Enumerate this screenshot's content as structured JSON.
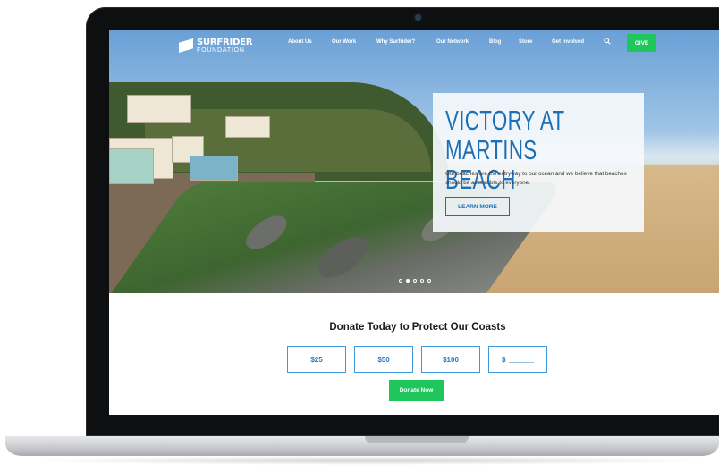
{
  "nav": {
    "logo_title": "SURFRIDER",
    "logo_subtitle": "FOUNDATION",
    "items": [
      "About Us",
      "Our Work",
      "Why Surfrider?",
      "Our Network",
      "Blog",
      "Store",
      "Get Involved"
    ],
    "give_label": "GIVE",
    "search_icon": "search-icon"
  },
  "hero": {
    "title": "VICTORY AT MARTINS BEACH",
    "text": "Our beaches are the entryway to our ocean and we believe that beaches should be accessible to everyone.",
    "cta_label": "LEARN MORE",
    "slides_total": 5,
    "active_slide": 2
  },
  "donate": {
    "title": "Donate Today to Protect Our Coasts",
    "amounts": [
      "$25",
      "$50",
      "$100"
    ],
    "custom_currency": "$",
    "submit_label": "Donate Now"
  },
  "colors": {
    "primary_blue": "#1f6fb5",
    "button_blue_border": "#3f97dc",
    "green": "#1ec65c"
  }
}
